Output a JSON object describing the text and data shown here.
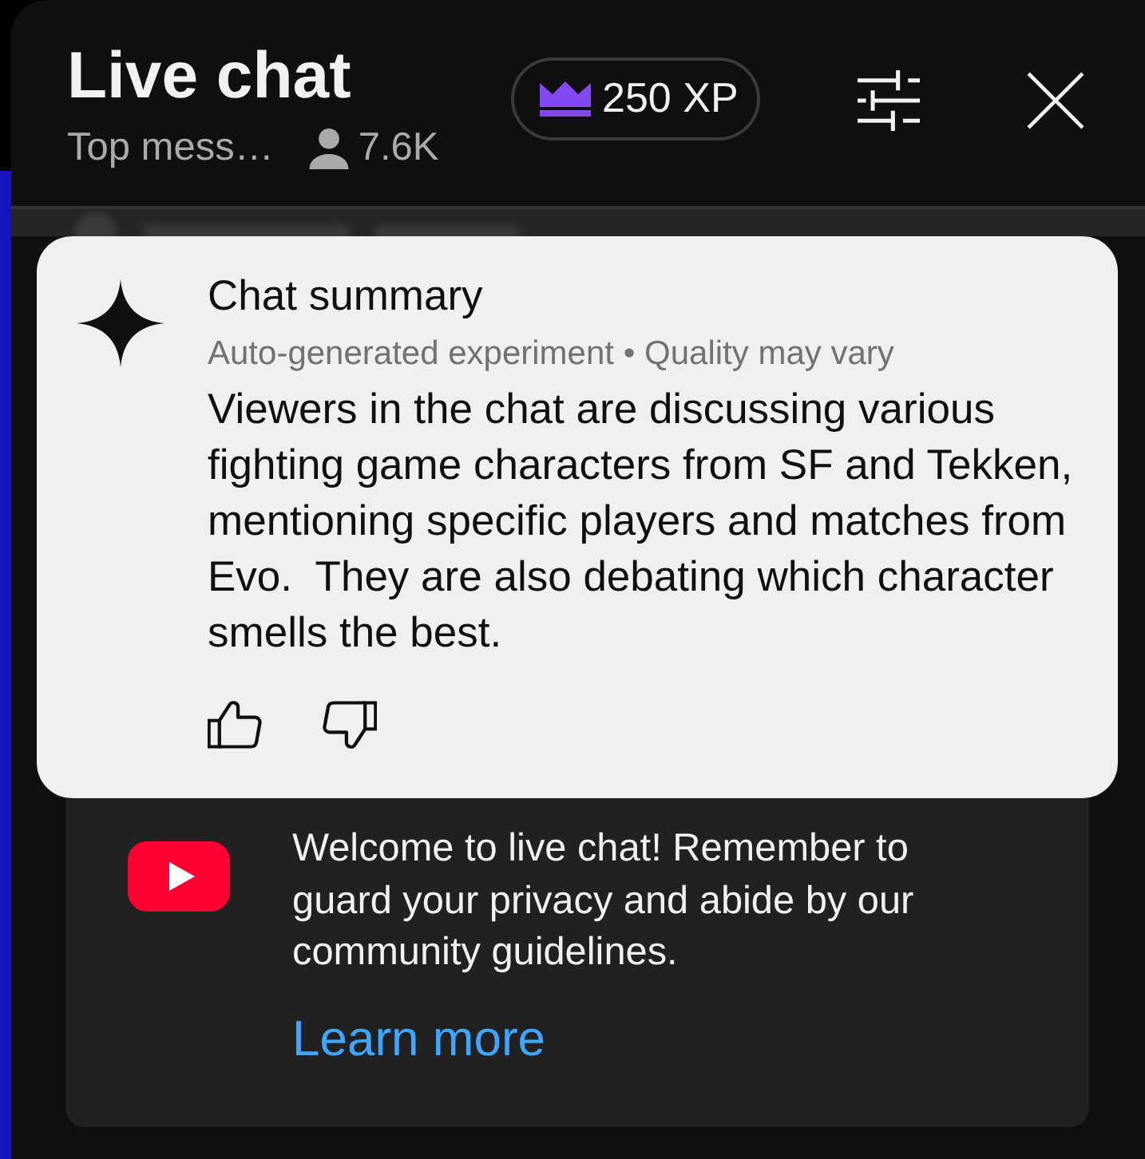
{
  "header": {
    "title": "Live chat",
    "filter": "Top mess…",
    "viewers": "7.6K",
    "xp": "250 XP"
  },
  "summary": {
    "title": "Chat summary",
    "subtitle": "Auto-generated experiment • Quality may vary",
    "text": "Viewers in the chat are discussing various fighting game characters from SF and Tekken, mentioning specific players and matches from Evo.  They are also debating which character smells the best.",
    "feedback": [
      {
        "kind": "like"
      },
      {
        "kind": "dislike"
      }
    ]
  },
  "welcome": {
    "text": "Welcome to live chat! Remember to guard your privacy and abide by our community guidelines.",
    "link": "Learn more"
  }
}
